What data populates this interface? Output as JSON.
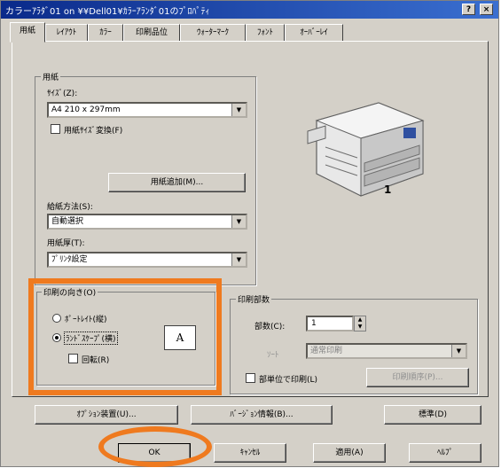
{
  "window": {
    "title": "カラーｱﾗﾀﾞ01 on ¥¥Dell01¥ｶﾗｰｱﾗﾝﾀﾞ01のﾌﾟﾛﾊﾟﾃｨ",
    "help_btn": "?",
    "close_btn": "×"
  },
  "tabs": [
    {
      "label": "用紙"
    },
    {
      "label": "ﾚｲｱｳﾄ"
    },
    {
      "label": "ｶﾗｰ"
    },
    {
      "label": "印刷品位"
    },
    {
      "label": "ｳｫｰﾀｰﾏｰｸ"
    },
    {
      "label": "ﾌｫﾝﾄ"
    },
    {
      "label": "ｵｰﾊﾞｰﾚｲ"
    }
  ],
  "paper": {
    "group_title": "用紙",
    "size_label": "ｻｲｽﾞ(Z):",
    "size_value": "A4 210 x 297mm",
    "fit_label": "用紙ｻｲｽﾞ変換(F)",
    "add_button": "用紙追加(M)...",
    "feed_label": "給紙方法(S):",
    "feed_value": "自動選択",
    "thickness_label": "用紙厚(T):",
    "thickness_value": "ﾌﾟﾘﾝﾀ設定"
  },
  "orientation": {
    "group_title": "印刷の向き(O)",
    "portrait": "ﾎﾟｰﾄﾚｲﾄ(縦)",
    "landscape": "ﾗﾝﾄﾞｽｹｰﾌﾟ(横)",
    "rotate": "回転(R)",
    "preview_letter": "A"
  },
  "copies": {
    "group_title": "印刷部数",
    "count_label": "部数(C):",
    "count_value": "1",
    "order_label": "ｿｰﾄ",
    "order_value": "通常印刷",
    "collate_label": "部単位で印刷(L)",
    "collate_button": "印刷順序(P)..."
  },
  "bottom_buttons": {
    "options": "ｵﾌﾟｼｮﾝ装置(U)...",
    "version": "ﾊﾞｰｼﾞｮﾝ情報(B)...",
    "standard": "標準(D)"
  },
  "dialog_buttons": {
    "ok": "OK",
    "cancel": "ｷｬﾝｾﾙ",
    "apply": "適用(A)",
    "help": "ﾍﾙﾌﾟ"
  },
  "colors": {
    "highlight": "#ef7a1f",
    "titlebar": "#0a2a8a",
    "face": "#d4d0c8"
  }
}
